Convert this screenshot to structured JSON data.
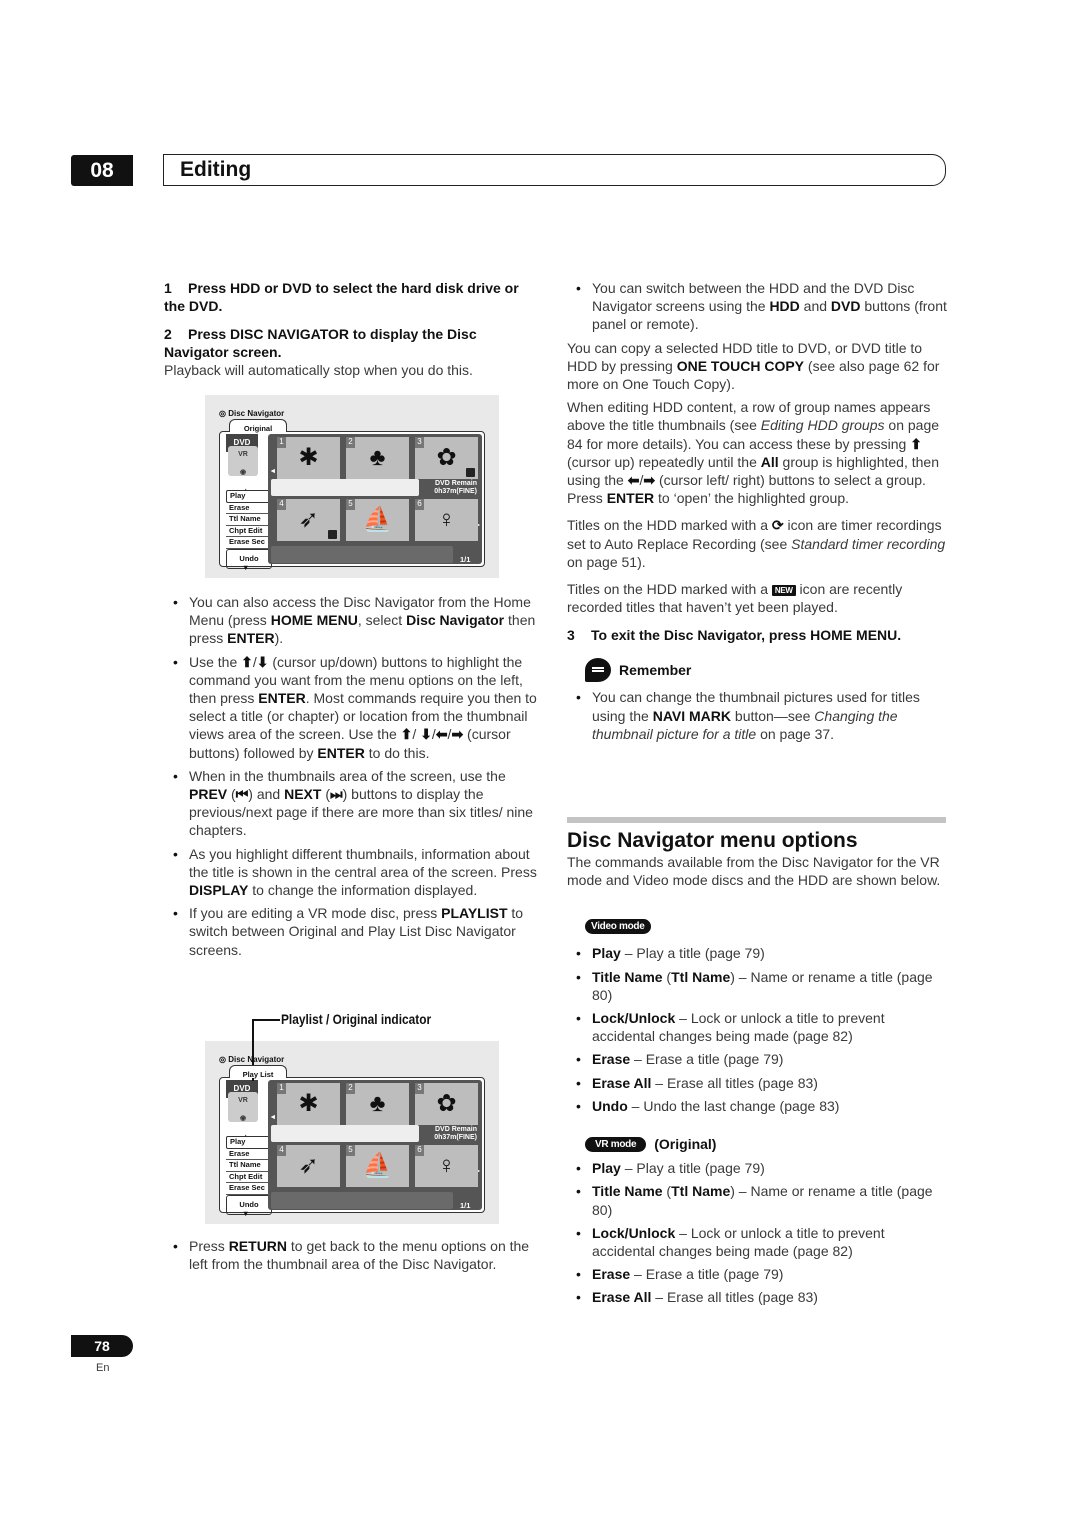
{
  "header": {
    "chapter": "08",
    "title": "Editing"
  },
  "left": {
    "step1": {
      "num": "1",
      "text": "Press HDD or DVD to select the hard disk drive or the DVD."
    },
    "step2": {
      "num": "2",
      "text": "Press DISC NAVIGATOR to display the Disc Navigator screen."
    },
    "step2_note": "Playback will automatically stop when you do this.",
    "bullets": [
      [
        {
          "t": "You can also access the Disc Navigator from the Home Menu (press "
        },
        {
          "b": "HOME MENU"
        },
        {
          "t": ", select "
        },
        {
          "b": "Disc Navigator"
        },
        {
          "t": " then press "
        },
        {
          "b": "ENTER"
        },
        {
          "t": ")."
        }
      ],
      [
        {
          "t": "Use the "
        },
        {
          "icon": "⬆"
        },
        {
          "t": "/"
        },
        {
          "icon": "⬇"
        },
        {
          "t": " (cursor up/down) buttons to highlight the command you want from the menu options on the left, then press "
        },
        {
          "b": "ENTER"
        },
        {
          "t": ". Most commands require you then to select a title (or chapter) or location from the thumbnail views area of the screen. Use the "
        },
        {
          "icon": "⬆"
        },
        {
          "t": "/ "
        },
        {
          "icon": "⬇"
        },
        {
          "t": "/"
        },
        {
          "icon": "⬅"
        },
        {
          "t": "/"
        },
        {
          "icon": "➡"
        },
        {
          "t": " (cursor buttons) followed by "
        },
        {
          "b": "ENTER"
        },
        {
          "t": " to do this."
        }
      ],
      [
        {
          "t": "When in the thumbnails area of the screen, use the "
        },
        {
          "b": "PREV"
        },
        {
          "t": " ("
        },
        {
          "b": "⏮"
        },
        {
          "t": ") and "
        },
        {
          "b": "NEXT"
        },
        {
          "t": " ("
        },
        {
          "b": "⏭"
        },
        {
          "t": ") buttons to display the previous/next page if there are more than six titles/ nine chapters."
        }
      ],
      [
        {
          "t": "As you highlight different thumbnails, information about the title is shown in the central area of the screen. Press "
        },
        {
          "b": "DISPLAY"
        },
        {
          "t": " to change the information displayed."
        }
      ],
      [
        {
          "t": "If you are editing a VR mode disc, press "
        },
        {
          "b": "PLAYLIST"
        },
        {
          "t": " to switch between Original and Play List Disc Navigator screens."
        }
      ]
    ],
    "indicator_label": "Playlist / Original indicator",
    "last_bullet": [
      {
        "t": "Press "
      },
      {
        "b": "RETURN"
      },
      {
        "t": " to get back to the menu options on the left from the thumbnail area of the Disc Navigator."
      }
    ]
  },
  "screens": [
    {
      "title": "Disc Navigator",
      "tab": "Original",
      "disc": "DVD",
      "mode": "VR",
      "menu": [
        "Play",
        "Erase",
        "Ttl Name",
        "Chpt Edit",
        "Erase Sec"
      ],
      "undo": "Undo",
      "remain_label": "DVD Remain",
      "remain_value": "0h37m(FINE)",
      "page": "1/1",
      "thumbs": [
        {
          "n": "1",
          "icon": "leaf",
          "locked": false
        },
        {
          "n": "2",
          "icon": "tree",
          "locked": false
        },
        {
          "n": "3",
          "icon": "lily",
          "locked": true
        },
        {
          "n": "4",
          "icon": "toucan",
          "locked": true
        },
        {
          "n": "5",
          "icon": "windsurfer",
          "locked": false
        },
        {
          "n": "6",
          "icon": "skater",
          "locked": false
        }
      ]
    },
    {
      "title": "Disc Navigator",
      "tab": "Play List",
      "disc": "DVD",
      "mode": "VR",
      "menu": [
        "Play",
        "Erase",
        "Ttl Name",
        "Chpt Edit",
        "Erase Sec"
      ],
      "undo": "Undo",
      "remain_label": "DVD Remain",
      "remain_value": "0h37m(FINE)",
      "page": "1/1",
      "thumbs": [
        {
          "n": "1",
          "icon": "leaf",
          "locked": false
        },
        {
          "n": "2",
          "icon": "tree",
          "locked": false
        },
        {
          "n": "3",
          "icon": "lily",
          "locked": false
        },
        {
          "n": "4",
          "icon": "toucan",
          "locked": false
        },
        {
          "n": "5",
          "icon": "windsurfer",
          "locked": false
        },
        {
          "n": "6",
          "icon": "skater",
          "locked": false
        }
      ]
    }
  ],
  "right": {
    "bullet1": [
      {
        "t": "You can switch between the HDD and the DVD Disc Navigator screens using the "
      },
      {
        "b": "HDD"
      },
      {
        "t": " and "
      },
      {
        "b": "DVD"
      },
      {
        "t": " buttons (front panel or remote)."
      }
    ],
    "para1": [
      {
        "t": "You can copy a selected HDD title to DVD, or DVD title to HDD by pressing "
      },
      {
        "b": "ONE TOUCH COPY"
      },
      {
        "t": " (see also page 62 for more on One Touch Copy)."
      }
    ],
    "para2": [
      {
        "t": "When editing HDD content, a row of group names appears above the title thumbnails (see "
      },
      {
        "i": "Editing HDD groups"
      },
      {
        "t": " on page 84 for more details). You can access these by pressing "
      },
      {
        "icon": "⬆"
      },
      {
        "t": " (cursor up) repeatedly until the "
      },
      {
        "b": "All"
      },
      {
        "t": " group is highlighted, then using the "
      },
      {
        "icon": "⬅"
      },
      {
        "t": "/"
      },
      {
        "icon": "➡"
      },
      {
        "t": " (cursor left/ right) buttons to select a group. Press "
      },
      {
        "b": "ENTER"
      },
      {
        "t": " to ‘open’ the highlighted group."
      }
    ],
    "para3": [
      {
        "t": "Titles on the HDD marked with a "
      },
      {
        "icon": "⟳"
      },
      {
        "t": " icon are timer recordings set to Auto Replace Recording (see "
      },
      {
        "i": "Standard timer recording"
      },
      {
        "t": " on page 51)."
      }
    ],
    "para4": [
      {
        "t": "Titles on the HDD marked with a "
      },
      {
        "tag": "NEW"
      },
      {
        "t": " icon are recently recorded titles that haven’t yet been played."
      }
    ],
    "step3": {
      "num": "3",
      "text": "To exit the Disc Navigator, press HOME MENU."
    },
    "remember": "Remember",
    "remember_bullet": [
      {
        "t": "You can change the thumbnail pictures used for titles using the "
      },
      {
        "b": "NAVI MARK"
      },
      {
        "t": " button—see "
      },
      {
        "i": "Changing the thumbnail picture for a title"
      },
      {
        "t": " on page 37."
      }
    ],
    "section_title": "Disc Navigator menu options",
    "section_intro": "The commands available from the Disc Navigator for the VR mode and Video mode discs and the HDD are shown below.",
    "video_badge": "Video mode",
    "video_items": [
      [
        {
          "b": "Play"
        },
        {
          "t": " – Play a title (page 79)"
        }
      ],
      [
        {
          "b": "Title Name"
        },
        {
          "t": " ("
        },
        {
          "b": "Ttl Name"
        },
        {
          "t": ") – Name or rename a title (page 80)"
        }
      ],
      [
        {
          "b": "Lock/Unlock"
        },
        {
          "t": " – Lock or unlock a title to prevent accidental changes being made (page 82)"
        }
      ],
      [
        {
          "b": "Erase"
        },
        {
          "t": " – Erase a title (page 79)"
        }
      ],
      [
        {
          "b": "Erase All"
        },
        {
          "t": " – Erase all titles (page 83)"
        }
      ],
      [
        {
          "b": "Undo"
        },
        {
          "t": " – Undo the last change (page 83)"
        }
      ]
    ],
    "vr_badge": "VR mode",
    "vr_heading": "(Original)",
    "vr_items": [
      [
        {
          "b": "Play"
        },
        {
          "t": " – Play a title (page 79)"
        }
      ],
      [
        {
          "b": "Title Name"
        },
        {
          "t": " ("
        },
        {
          "b": "Ttl Name"
        },
        {
          "t": ") – Name or rename a title (page 80)"
        }
      ],
      [
        {
          "b": "Lock/Unlock"
        },
        {
          "t": " – Lock or unlock a title to prevent accidental changes being made (page 82)"
        }
      ],
      [
        {
          "b": "Erase"
        },
        {
          "t": " – Erase a title (page 79)"
        }
      ],
      [
        {
          "b": "Erase All"
        },
        {
          "t": " – Erase all titles (page 83)"
        }
      ]
    ]
  },
  "footer": {
    "page_number": "78",
    "lang": "En"
  }
}
